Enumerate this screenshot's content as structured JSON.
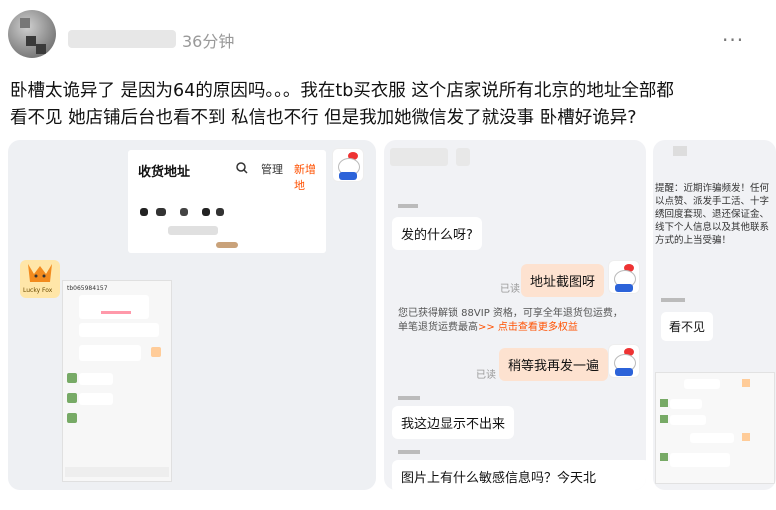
{
  "header": {
    "time": "36分钟",
    "more_label": "···"
  },
  "post": {
    "text_line1": "卧槽太诡异了 是因为64的原因吗。。。我在tb买衣服 这个店家说所有北京的地址全部都",
    "text_line2": "看不见 她店铺后台也看不到 私信也不行 但是我加她微信发了就没事 卧槽好诡异?"
  },
  "images": {
    "card1": {
      "panel_title": "收货地址",
      "manage": "管理",
      "add_new": "新增地",
      "fox_label": "Lucky Fox",
      "chat_id": "tb065984157"
    },
    "card2": {
      "msg1": "发的什么呀?",
      "msg2": "地址截图呀",
      "read1": "已读",
      "vip_note": "您已获得解锁 88VIP 资格，可享全年退货包运费，单笔退货运费最高",
      "vip_link": ">> 点击查看更多权益",
      "msg3": "稍等我再发一遍",
      "read2": "已读",
      "msg4": "我这边显示不出来",
      "msg5": "图片上有什么敏感信息吗？今天北"
    },
    "card3": {
      "warning": "提醒：近期诈骗频发！任何以点赞、派发手工活、十字绣回度套现、退还保证金、线下个人信息以及其他联系方式的上当受骗！",
      "msg": "看不见"
    }
  },
  "colors": {
    "accent": "#ff5000",
    "bubble_self": "#fde2d0",
    "muted": "#999999"
  }
}
